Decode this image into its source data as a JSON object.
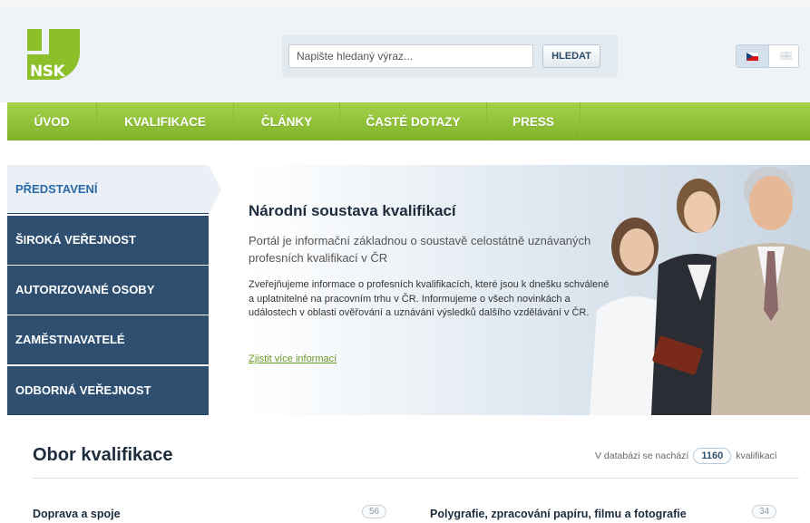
{
  "header": {
    "logo_text": "NSK",
    "search": {
      "placeholder": "Napište hledaný výraz...",
      "button_label": "HLEDAT"
    },
    "languages": [
      "cs",
      "en"
    ]
  },
  "nav": {
    "items": [
      {
        "label": "ÚVOD"
      },
      {
        "label": "KVALIFIKACE"
      },
      {
        "label": "ČLÁNKY"
      },
      {
        "label": "ČASTÉ DOTAZY"
      },
      {
        "label": "PRESS"
      }
    ]
  },
  "sidebar": {
    "items": [
      {
        "label": "PŘEDSTAVENÍ",
        "active": true
      },
      {
        "label": "ŠIROKÁ VEŘEJNOST"
      },
      {
        "label": "AUTORIZOVANÉ OSOBY"
      },
      {
        "label": "ZAMĚSTNAVATELÉ"
      },
      {
        "label": "ODBORNÁ VEŘEJNOST"
      }
    ]
  },
  "hero": {
    "title": "Národní soustava kvalifikací",
    "lead": "Portál je informační základnou o soustavě celostátně uznávaných profesních kvalifikací v ČR",
    "body": "Zveřejňujeme informace o profesních kvalifikacích, které jsou k dnešku schválené a uplatnitelné na pracovním trhu v ČR. Informujeme o všech novinkách a událostech v oblasti ověřování a uznávání výsledků dalšího vzdělávání v ČR.",
    "link": "Zjistit více informací"
  },
  "fields": {
    "title": "Obor kvalifikace",
    "db_prefix": "V databázi se nachází",
    "db_count": "1160",
    "db_suffix": "kvalifikací",
    "items": [
      {
        "name": "Doprava a spoje",
        "count": "56"
      },
      {
        "name": "Polygrafie, zpracování papíru, filmu a fotografie",
        "count": "34"
      }
    ]
  },
  "colors": {
    "nav_green": "#8cbf2a",
    "sidebar_blue": "#2e4f70",
    "link_green": "#6a9a23"
  }
}
